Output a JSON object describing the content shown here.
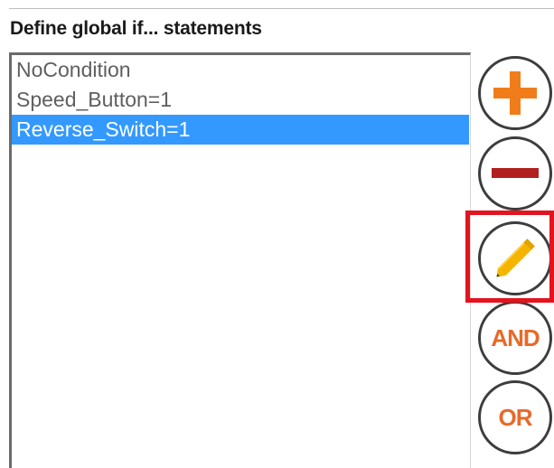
{
  "title": "Define global if... statements",
  "conditions": {
    "items": [
      {
        "label": "NoCondition",
        "selected": false
      },
      {
        "label": "Speed_Button=1",
        "selected": false
      },
      {
        "label": "Reverse_Switch=1",
        "selected": true
      }
    ],
    "selected_index": 2
  },
  "buttons": {
    "add": {
      "icon": "plus-icon",
      "color": "#f07d1a"
    },
    "remove": {
      "icon": "minus-icon",
      "color": "#b11e1e"
    },
    "edit": {
      "icon": "pencil-icon",
      "color": "#f5b400",
      "highlighted": true
    },
    "and_label": "AND",
    "or_label": "OR"
  },
  "colors": {
    "selection": "#3399ff",
    "highlight": "#e3141f",
    "button_text": "#e8692a"
  }
}
